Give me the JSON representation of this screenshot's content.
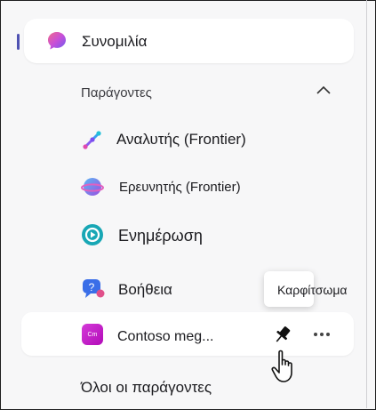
{
  "chat": {
    "label": "Συνομιλία"
  },
  "agents_section": {
    "label": "Παράγοντες"
  },
  "agents": [
    {
      "label": "Αναλυτής (Frontier)"
    },
    {
      "label": "Ερευνητής (Frontier)"
    },
    {
      "label": "Ενημέρωση"
    },
    {
      "label": "Βοήθεια"
    }
  ],
  "contoso": {
    "label": "Contoso meg...",
    "badge": "Cm"
  },
  "tooltip": {
    "text": "Καρφίτσωμα"
  },
  "footer": {
    "all_agents": "Όλοι οι παράγοντες"
  },
  "colors": {
    "accent": "#4f52b2",
    "contoso_badge": "#c71fcc"
  }
}
